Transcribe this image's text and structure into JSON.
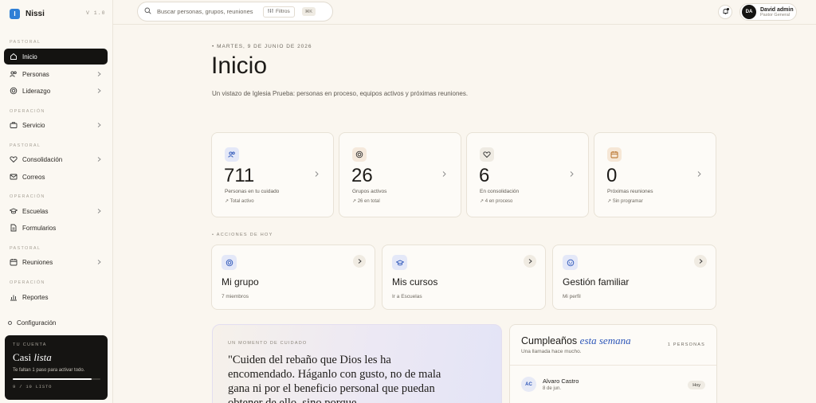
{
  "app": {
    "name": "Nissi",
    "version": "V 1.0",
    "logo_letter": "I"
  },
  "sidebar": {
    "sections": [
      "PASTORAL",
      "OPERACIÓN",
      "PASTORAL",
      "OPERACIÓN",
      "PASTORAL",
      "OPERACIÓN"
    ],
    "items": [
      {
        "label": "Inicio"
      },
      {
        "label": "Personas"
      },
      {
        "label": "Liderazgo"
      },
      {
        "label": "Servicio"
      },
      {
        "label": "Consolidación"
      },
      {
        "label": "Correos"
      },
      {
        "label": "Escuelas"
      },
      {
        "label": "Formularios"
      },
      {
        "label": "Reuniones"
      },
      {
        "label": "Reportes"
      }
    ],
    "config_label": "Configuración",
    "onboarding": {
      "kicker": "TU CUENTA",
      "title_main": "Casi",
      "title_em": "lista",
      "desc": "Te faltan 1 paso para activar todo.",
      "progress": 0.9,
      "progress_text": "9 / 10 LISTO"
    }
  },
  "topbar": {
    "search_placeholder": "Buscar personas, grupos, reuniones",
    "filters_label": "Filtros",
    "shortcut": "⌘K",
    "user": {
      "initials": "DA",
      "name": "David admin",
      "role": "Pastor General"
    }
  },
  "main": {
    "date": "MARTES, 9 DE JUNIO DE 2026",
    "title": "Inicio",
    "description": "Un vistazo de Iglesia Prueba: personas en proceso, equipos activos y próximas reuniones.",
    "stats": [
      {
        "value": "711",
        "label": "Personas en tu cuidado",
        "sub": "↗ Total activo",
        "icon": "people-icon",
        "color": "#e4e8f8"
      },
      {
        "value": "26",
        "label": "Grupos activos",
        "sub": "↗ 26 en total",
        "icon": "target-icon",
        "color": "#f5e9dc"
      },
      {
        "value": "6",
        "label": "En consolidación",
        "sub": "↗ 4 en proceso",
        "icon": "heart-icon",
        "color": "#efebe3"
      },
      {
        "value": "0",
        "label": "Próximas reuniones",
        "sub": "↗ Sin programar",
        "icon": "calendar-icon",
        "color": "#f6e7d6"
      }
    ],
    "quick_title": "ACCIONES DE HOY",
    "quick": [
      {
        "title": "Mi grupo",
        "sub": "7 miembros",
        "icon": "target-icon",
        "color": "#e4e8f8"
      },
      {
        "title": "Mis cursos",
        "sub": "Ir a Escuelas",
        "icon": "graduation-icon",
        "color": "#e4e8f8"
      },
      {
        "title": "Gestión familiar",
        "sub": "Mi perfil",
        "icon": "family-icon",
        "color": "#e4e8f8"
      }
    ],
    "verse": {
      "kicker": "UN MOMENTO DE CUIDADO",
      "text": "\"Cuiden del rebaño que Dios les ha encomendado. Háganlo con gusto, no de mala gana ni por el beneficio personal que puedan obtener de ello, sino porque"
    },
    "birthdays": {
      "title": "Cumpleaños",
      "title_em": "esta semana",
      "sub": "Una llamada hace mucho.",
      "count": "1 PERSONAS",
      "people": [
        {
          "initials": "AC",
          "name": "Alvaro Castro",
          "date": "8 de jun.",
          "tag": "Hoy"
        }
      ]
    }
  }
}
